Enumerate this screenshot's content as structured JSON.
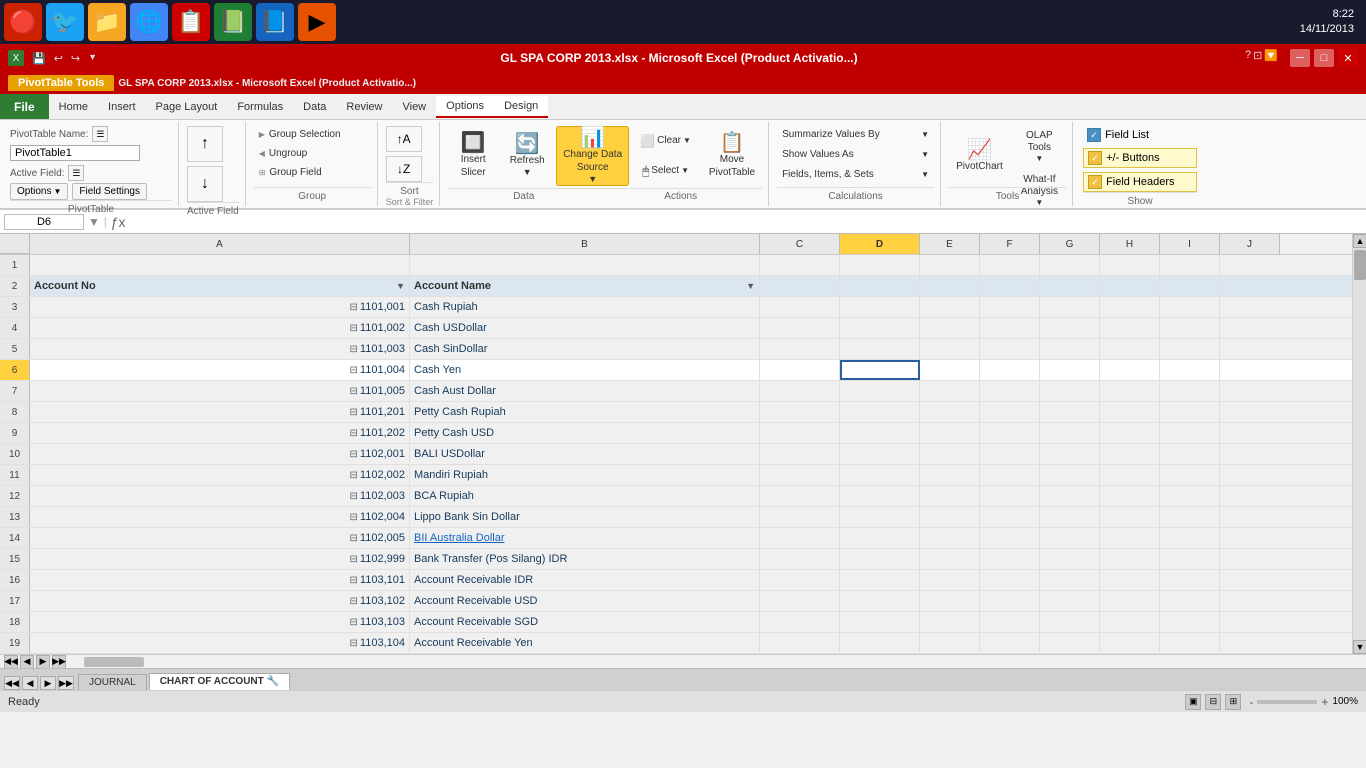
{
  "taskbar": {
    "icons": [
      "🔴",
      "🐦",
      "📁",
      "🌐",
      "📋",
      "📗",
      "📘",
      "▶"
    ],
    "time": "8:22",
    "date": "14/11/2013"
  },
  "titlebar": {
    "title": "GL SPA CORP 2013.xlsx - Microsoft Excel (Product Activatio...)",
    "controls": [
      "─",
      "□",
      "✕"
    ]
  },
  "pivot_tools": {
    "banner_label": "PivotTable Tools",
    "tabs": [
      "Options",
      "Design"
    ]
  },
  "menubar": {
    "file_label": "File",
    "items": [
      "Home",
      "Insert",
      "Page Layout",
      "Formulas",
      "Data",
      "Review",
      "View",
      "Options",
      "Design"
    ]
  },
  "ribbon": {
    "pivot_table": {
      "name_label": "PivotTable Name:",
      "name_value": "PivotTable1",
      "active_field_label": "Active Field:",
      "options_label": "Options",
      "field_settings_label": "Field Settings",
      "group_label": "PivotTable"
    },
    "active_field": {
      "group_label": "Active Field"
    },
    "group_section": {
      "group_selection": "Group Selection",
      "ungroup": "Ungroup",
      "group_field": "Group Field",
      "group_label": "Group"
    },
    "sort_filter": {
      "sort_label": "Sort",
      "sort_label2": "Sort & Filter"
    },
    "data": {
      "insert_slicer": "Insert\nSlicer",
      "refresh": "Refresh",
      "change_data_source": "Change Data\nSource",
      "clear": "Clear",
      "select": "Select",
      "move_pivot": "Move\nPivotTable",
      "group_label": "Data",
      "actions_label": "Actions"
    },
    "calculations": {
      "summarize_values": "Summarize Values By",
      "show_values_as": "Show Values As",
      "fields_items": "Fields, Items, & Sets",
      "group_label": "Calculations"
    },
    "tools": {
      "pivot_chart": "PivotChart",
      "olap_tools": "OLAP\nTools",
      "what_if": "What-If\nAnalysis",
      "group_label": "Tools"
    },
    "show": {
      "field_list": "Field List",
      "buttons": "+/- Buttons",
      "field_headers": "Field Headers",
      "group_label": "Show"
    }
  },
  "formula_bar": {
    "cell_ref": "D6",
    "formula": ""
  },
  "columns": {
    "headers": [
      "A",
      "B",
      "C",
      "D",
      "E",
      "F",
      "G",
      "H",
      "I",
      "J"
    ]
  },
  "spreadsheet": {
    "header_row": {
      "row_num": "2",
      "account_no": "Account No",
      "account_name": "Account Name"
    },
    "rows": [
      {
        "num": "1",
        "a": "",
        "b": "",
        "c": "",
        "d": "",
        "e": "",
        "f": "",
        "g": "",
        "h": "",
        "i": ""
      },
      {
        "num": "2",
        "a": "Account No",
        "b": "Account Name",
        "c": "",
        "d": "",
        "e": "",
        "f": "",
        "g": "",
        "h": "",
        "i": ""
      },
      {
        "num": "3",
        "a": "1101,001",
        "b": "Cash Rupiah",
        "c": "",
        "d": "",
        "e": "",
        "f": "",
        "g": "",
        "h": "",
        "i": ""
      },
      {
        "num": "4",
        "a": "1101,002",
        "b": "Cash USDollar",
        "c": "",
        "d": "",
        "e": "",
        "f": "",
        "g": "",
        "h": "",
        "i": ""
      },
      {
        "num": "5",
        "a": "1101,003",
        "b": "Cash SinDollar",
        "c": "",
        "d": "",
        "e": "",
        "f": "",
        "g": "",
        "h": "",
        "i": ""
      },
      {
        "num": "6",
        "a": "1101,004",
        "b": "Cash Yen",
        "c": "",
        "d": "",
        "e": "",
        "f": "",
        "g": "",
        "h": "",
        "i": ""
      },
      {
        "num": "7",
        "a": "1101,005",
        "b": "Cash Aust Dollar",
        "c": "",
        "d": "",
        "e": "",
        "f": "",
        "g": "",
        "h": "",
        "i": ""
      },
      {
        "num": "8",
        "a": "1101,201",
        "b": "Petty Cash Rupiah",
        "c": "",
        "d": "",
        "e": "",
        "f": "",
        "g": "",
        "h": "",
        "i": ""
      },
      {
        "num": "9",
        "a": "1101,202",
        "b": "Petty Cash USD",
        "c": "",
        "d": "",
        "e": "",
        "f": "",
        "g": "",
        "h": "",
        "i": ""
      },
      {
        "num": "10",
        "a": "1102,001",
        "b": "BALI USDollar",
        "c": "",
        "d": "",
        "e": "",
        "f": "",
        "g": "",
        "h": "",
        "i": ""
      },
      {
        "num": "11",
        "a": "1102,002",
        "b": "Mandiri Rupiah",
        "c": "",
        "d": "",
        "e": "",
        "f": "",
        "g": "",
        "h": "",
        "i": ""
      },
      {
        "num": "12",
        "a": "1102,003",
        "b": "BCA Rupiah",
        "c": "",
        "d": "",
        "e": "",
        "f": "",
        "g": "",
        "h": "",
        "i": ""
      },
      {
        "num": "13",
        "a": "1102,004",
        "b": "Lippo Bank Sin Dollar",
        "c": "",
        "d": "",
        "e": "",
        "f": "",
        "g": "",
        "h": "",
        "i": ""
      },
      {
        "num": "14",
        "a": "1102,005",
        "b": "BII Australia Dollar",
        "c": "",
        "d": "",
        "e": "",
        "f": "",
        "g": "",
        "h": "",
        "i": ""
      },
      {
        "num": "15",
        "a": "1102,999",
        "b": "Bank Transfer (Pos Silang) IDR",
        "c": "",
        "d": "",
        "e": "",
        "f": "",
        "g": "",
        "h": "",
        "i": ""
      },
      {
        "num": "16",
        "a": "1103,101",
        "b": "Account Receivable IDR",
        "c": "",
        "d": "",
        "e": "",
        "f": "",
        "g": "",
        "h": "",
        "i": ""
      },
      {
        "num": "17",
        "a": "1103,102",
        "b": "Account Receivable USD",
        "c": "",
        "d": "",
        "e": "",
        "f": "",
        "g": "",
        "h": "",
        "i": ""
      },
      {
        "num": "18",
        "a": "1103,103",
        "b": "Account Receivable SGD",
        "c": "",
        "d": "",
        "e": "",
        "f": "",
        "g": "",
        "h": "",
        "i": ""
      },
      {
        "num": "19",
        "a": "1103,104",
        "b": "Account Receivable Yen",
        "c": "",
        "d": "",
        "e": "",
        "f": "",
        "g": "",
        "h": "",
        "i": ""
      }
    ]
  },
  "sheet_tabs": {
    "tabs": [
      "JOURNAL",
      "CHART OF ACCOUNT"
    ],
    "active": "CHART OF ACCOUNT"
  },
  "statusbar": {
    "status": "Ready",
    "zoom": "100%"
  }
}
